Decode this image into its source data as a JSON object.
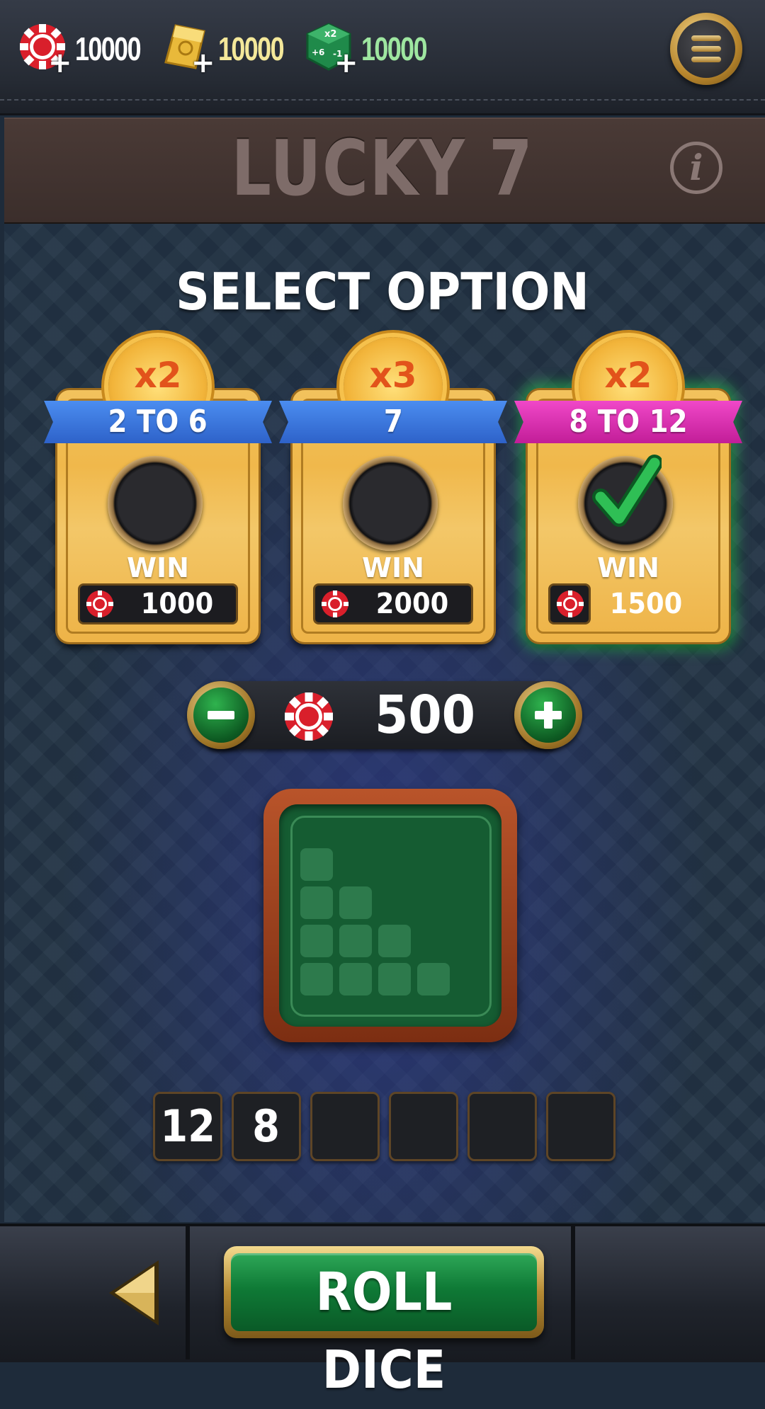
{
  "resources": {
    "chips": {
      "icon": "poker-chip-icon",
      "value": "10000"
    },
    "gold": {
      "icon": "gold-bar-icon",
      "value": "10000"
    },
    "dice": {
      "icon": "green-dice-icon",
      "value": "10000"
    }
  },
  "title": "LUCKY 7",
  "heading": "SELECT OPTION",
  "options": [
    {
      "multiplier": "x2",
      "label": "2 TO 6",
      "win_label": "WIN",
      "win_amount": "1000",
      "selected": false,
      "ribbon_color": "#3a76dd"
    },
    {
      "multiplier": "x3",
      "label": "7",
      "win_label": "WIN",
      "win_amount": "2000",
      "selected": false,
      "ribbon_color": "#3a76dd"
    },
    {
      "multiplier": "x2",
      "label": "8 TO 12",
      "win_label": "WIN",
      "win_amount": "1500",
      "selected": true,
      "ribbon_color": "#dc34b4"
    }
  ],
  "bet": {
    "value": "500"
  },
  "history": [
    "12",
    "8",
    "",
    "",
    "",
    ""
  ],
  "roll_button": "ROLL DICE",
  "colors": {
    "resource_chips": "#ffffff",
    "resource_gold": "#f4e89a",
    "resource_dice": "#9ee6a0",
    "multiplier": "#e2531b",
    "accent_green": "#0f7a36"
  }
}
